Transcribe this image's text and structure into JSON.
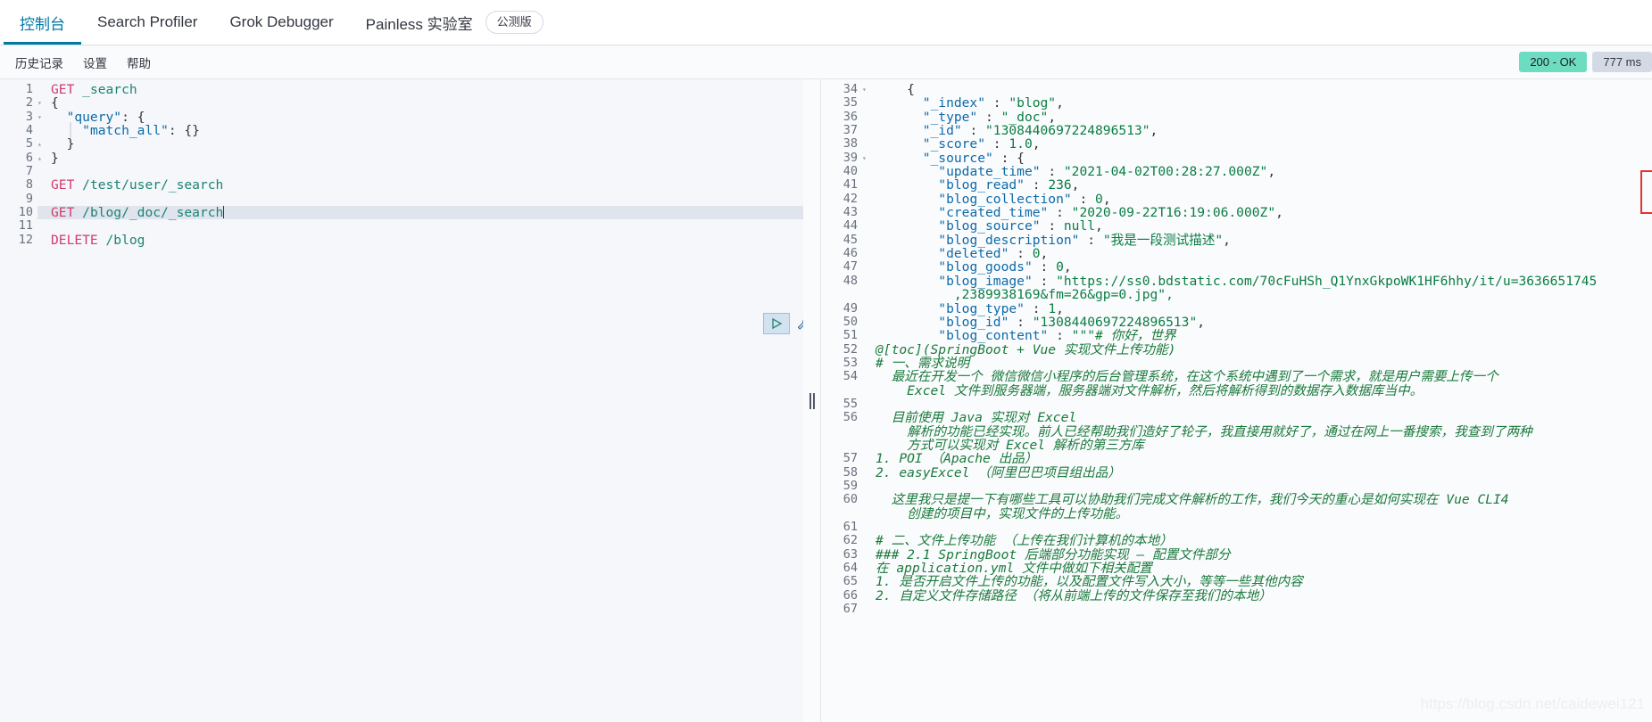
{
  "topbar": {
    "tabs": [
      {
        "label": "控制台",
        "active": true
      },
      {
        "label": "Search Profiler",
        "active": false
      },
      {
        "label": "Grok Debugger",
        "active": false
      },
      {
        "label": "Painless 实验室",
        "active": false
      }
    ],
    "beta_badge": "公测版"
  },
  "submenu": {
    "items": [
      "历史记录",
      "设置",
      "帮助"
    ],
    "status_code": "200 - OK",
    "status_time": "777 ms"
  },
  "colors": {
    "accent": "#0079a5",
    "status_ok_bg": "#6ddcc0",
    "status_time_bg": "#d3dae6",
    "annotation_box": "#e8312f",
    "method": "#d13c6e",
    "url": "#1b8474",
    "key": "#0d6aa8",
    "string": "#0a7d43",
    "markdown": "#1a7a3c",
    "highlight_row": "#dfe4ed"
  },
  "request_editor": {
    "lines": [
      {
        "n": "1",
        "fold": "",
        "segments": [
          {
            "t": "GET",
            "c": "k-method"
          },
          {
            "t": " ",
            "c": "k-plain"
          },
          {
            "t": "_search",
            "c": "k-url"
          }
        ]
      },
      {
        "n": "2",
        "fold": "▾",
        "segments": [
          {
            "t": "{",
            "c": "k-punc"
          }
        ]
      },
      {
        "n": "3",
        "fold": "▾",
        "segments": [
          {
            "t": "  ",
            "c": "k-plain"
          },
          {
            "t": "\"query\"",
            "c": "k-key"
          },
          {
            "t": ": {",
            "c": "k-punc"
          }
        ]
      },
      {
        "n": "4",
        "fold": "",
        "segments": [
          {
            "t": "  │ ",
            "c": "indent-guides"
          },
          {
            "t": "\"match_all\"",
            "c": "k-key"
          },
          {
            "t": ": {}",
            "c": "k-punc"
          }
        ]
      },
      {
        "n": "5",
        "fold": "▴",
        "segments": [
          {
            "t": "  }",
            "c": "k-punc"
          }
        ]
      },
      {
        "n": "6",
        "fold": "▴",
        "segments": [
          {
            "t": "}",
            "c": "k-punc"
          }
        ]
      },
      {
        "n": "7",
        "fold": "",
        "segments": []
      },
      {
        "n": "8",
        "fold": "",
        "segments": [
          {
            "t": "GET",
            "c": "k-method"
          },
          {
            "t": " ",
            "c": "k-plain"
          },
          {
            "t": "/test/user/_search",
            "c": "k-url"
          }
        ]
      },
      {
        "n": "9",
        "fold": "",
        "segments": []
      },
      {
        "n": "10",
        "fold": "",
        "highlight": true,
        "cursor": true,
        "segments": [
          {
            "t": "GET",
            "c": "k-method"
          },
          {
            "t": " ",
            "c": "k-plain"
          },
          {
            "t": "/blog/_doc/_search",
            "c": "k-url"
          }
        ]
      },
      {
        "n": "11",
        "fold": "",
        "segments": []
      },
      {
        "n": "12",
        "fold": "",
        "segments": [
          {
            "t": "DELETE",
            "c": "k-method"
          },
          {
            "t": " ",
            "c": "k-plain"
          },
          {
            "t": "/blog",
            "c": "k-url"
          }
        ]
      }
    ],
    "actions": {
      "play_label": "▷",
      "wrench_label": "🔧"
    }
  },
  "response_editor": {
    "lines": [
      {
        "n": "34",
        "fold": "▾",
        "segments": [
          {
            "t": "    {",
            "c": "k-punc"
          }
        ]
      },
      {
        "n": "35",
        "fold": "",
        "segments": [
          {
            "t": "      ",
            "c": "k-plain"
          },
          {
            "t": "\"_index\"",
            "c": "k-key"
          },
          {
            "t": " : ",
            "c": "k-punc"
          },
          {
            "t": "\"blog\"",
            "c": "k-str"
          },
          {
            "t": ",",
            "c": "k-punc"
          }
        ]
      },
      {
        "n": "36",
        "fold": "",
        "segments": [
          {
            "t": "      ",
            "c": "k-plain"
          },
          {
            "t": "\"_type\"",
            "c": "k-key"
          },
          {
            "t": " : ",
            "c": "k-punc"
          },
          {
            "t": "\"_doc\"",
            "c": "k-str"
          },
          {
            "t": ",",
            "c": "k-punc"
          }
        ]
      },
      {
        "n": "37",
        "fold": "",
        "segments": [
          {
            "t": "      ",
            "c": "k-plain"
          },
          {
            "t": "\"_id\"",
            "c": "k-key"
          },
          {
            "t": " : ",
            "c": "k-punc"
          },
          {
            "t": "\"1308440697224896513\"",
            "c": "k-str"
          },
          {
            "t": ",",
            "c": "k-punc"
          }
        ]
      },
      {
        "n": "38",
        "fold": "",
        "segments": [
          {
            "t": "      ",
            "c": "k-plain"
          },
          {
            "t": "\"_score\"",
            "c": "k-key"
          },
          {
            "t": " : ",
            "c": "k-punc"
          },
          {
            "t": "1.0",
            "c": "k-num"
          },
          {
            "t": ",",
            "c": "k-punc"
          }
        ]
      },
      {
        "n": "39",
        "fold": "▾",
        "segments": [
          {
            "t": "      ",
            "c": "k-plain"
          },
          {
            "t": "\"_source\"",
            "c": "k-key"
          },
          {
            "t": " : {",
            "c": "k-punc"
          }
        ]
      },
      {
        "n": "40",
        "fold": "",
        "segments": [
          {
            "t": "        ",
            "c": "k-plain"
          },
          {
            "t": "\"update_time\"",
            "c": "k-key"
          },
          {
            "t": " : ",
            "c": "k-punc"
          },
          {
            "t": "\"2021-04-02T00:28:27.000Z\"",
            "c": "k-str"
          },
          {
            "t": ",",
            "c": "k-punc"
          }
        ]
      },
      {
        "n": "41",
        "fold": "",
        "segments": [
          {
            "t": "        ",
            "c": "k-plain"
          },
          {
            "t": "\"blog_read\"",
            "c": "k-key"
          },
          {
            "t": " : ",
            "c": "k-punc"
          },
          {
            "t": "236",
            "c": "k-num"
          },
          {
            "t": ",",
            "c": "k-punc"
          }
        ]
      },
      {
        "n": "42",
        "fold": "",
        "segments": [
          {
            "t": "        ",
            "c": "k-plain"
          },
          {
            "t": "\"blog_collection\"",
            "c": "k-key"
          },
          {
            "t": " : ",
            "c": "k-punc"
          },
          {
            "t": "0",
            "c": "k-num"
          },
          {
            "t": ",",
            "c": "k-punc"
          }
        ]
      },
      {
        "n": "43",
        "fold": "",
        "segments": [
          {
            "t": "        ",
            "c": "k-plain"
          },
          {
            "t": "\"created_time\"",
            "c": "k-key"
          },
          {
            "t": " : ",
            "c": "k-punc"
          },
          {
            "t": "\"2020-09-22T16:19:06.000Z\"",
            "c": "k-str"
          },
          {
            "t": ",",
            "c": "k-punc"
          }
        ]
      },
      {
        "n": "44",
        "fold": "",
        "segments": [
          {
            "t": "        ",
            "c": "k-plain"
          },
          {
            "t": "\"blog_source\"",
            "c": "k-key"
          },
          {
            "t": " : ",
            "c": "k-punc"
          },
          {
            "t": "null",
            "c": "k-num"
          },
          {
            "t": ",",
            "c": "k-punc"
          }
        ]
      },
      {
        "n": "45",
        "fold": "",
        "segments": [
          {
            "t": "        ",
            "c": "k-plain"
          },
          {
            "t": "\"blog_description\"",
            "c": "k-key"
          },
          {
            "t": " : ",
            "c": "k-punc"
          },
          {
            "t": "\"我是一段测试描述\"",
            "c": "k-str"
          },
          {
            "t": ",",
            "c": "k-punc"
          }
        ]
      },
      {
        "n": "46",
        "fold": "",
        "segments": [
          {
            "t": "        ",
            "c": "k-plain"
          },
          {
            "t": "\"deleted\"",
            "c": "k-key"
          },
          {
            "t": " : ",
            "c": "k-punc"
          },
          {
            "t": "0",
            "c": "k-num"
          },
          {
            "t": ",",
            "c": "k-punc"
          }
        ]
      },
      {
        "n": "47",
        "fold": "",
        "segments": [
          {
            "t": "        ",
            "c": "k-plain"
          },
          {
            "t": "\"blog_goods\"",
            "c": "k-key"
          },
          {
            "t": " : ",
            "c": "k-punc"
          },
          {
            "t": "0",
            "c": "k-num"
          },
          {
            "t": ",",
            "c": "k-punc"
          }
        ]
      },
      {
        "n": "48",
        "fold": "",
        "wrap": true,
        "segments": [
          {
            "t": "        ",
            "c": "k-plain"
          },
          {
            "t": "\"blog_image\"",
            "c": "k-key"
          },
          {
            "t": " : ",
            "c": "k-punc"
          },
          {
            "t": "\"https://ss0.bdstatic.com/70cFuHSh_Q1YnxGkpoWK1HF6hhy/it/u=3636651745",
            "c": "k-str"
          }
        ]
      },
      {
        "n": "",
        "fold": "",
        "continuation": true,
        "segments": [
          {
            "t": "          ,2389938169&fm=26&gp=0.jpg\",",
            "c": "k-str"
          }
        ]
      },
      {
        "n": "49",
        "fold": "",
        "segments": [
          {
            "t": "        ",
            "c": "k-plain"
          },
          {
            "t": "\"blog_type\"",
            "c": "k-key"
          },
          {
            "t": " : ",
            "c": "k-punc"
          },
          {
            "t": "1",
            "c": "k-num"
          },
          {
            "t": ",",
            "c": "k-punc"
          }
        ]
      },
      {
        "n": "50",
        "fold": "",
        "segments": [
          {
            "t": "        ",
            "c": "k-plain"
          },
          {
            "t": "\"blog_id\"",
            "c": "k-key"
          },
          {
            "t": " : ",
            "c": "k-punc"
          },
          {
            "t": "\"1308440697224896513\"",
            "c": "k-str"
          },
          {
            "t": ",",
            "c": "k-punc"
          }
        ]
      },
      {
        "n": "51",
        "fold": "",
        "segments": [
          {
            "t": "        ",
            "c": "k-plain"
          },
          {
            "t": "\"blog_content\"",
            "c": "k-key"
          },
          {
            "t": " : ",
            "c": "k-punc"
          },
          {
            "t": "\"\"\"",
            "c": "k-str"
          },
          {
            "t": "# 你好，世界",
            "c": "md"
          }
        ]
      },
      {
        "n": "52",
        "fold": "",
        "nogutterbar": true,
        "segments": [
          {
            "t": "@[toc](SpringBoot + Vue 实现文件上传功能)",
            "c": "md"
          }
        ]
      },
      {
        "n": "53",
        "fold": "",
        "nogutterbar": true,
        "segments": [
          {
            "t": "# 一、需求说明",
            "c": "md"
          }
        ]
      },
      {
        "n": "54",
        "fold": "",
        "nogutterbar": true,
        "segments": [
          {
            "t": "  最近在开发一个 微信微信小程序的后台管理系统，在这个系统中遇到了一个需求，就是用户需要上传一个",
            "c": "md"
          }
        ]
      },
      {
        "n": "",
        "fold": "",
        "continuation": true,
        "nogutterbar": true,
        "segments": [
          {
            "t": "    Excel 文件到服务器端，服务器端对文件解析，然后将解析得到的数据存入数据库当中。",
            "c": "md"
          }
        ]
      },
      {
        "n": "55",
        "fold": "",
        "nogutterbar": true,
        "segments": []
      },
      {
        "n": "56",
        "fold": "",
        "nogutterbar": true,
        "segments": [
          {
            "t": "  目前使用 Java 实现对 Excel",
            "c": "md"
          }
        ]
      },
      {
        "n": "",
        "fold": "",
        "continuation": true,
        "nogutterbar": true,
        "segments": [
          {
            "t": "    解析的功能已经实现。前人已经帮助我们造好了轮子，我直接用就好了，通过在网上一番搜索，我查到了两种",
            "c": "md"
          }
        ]
      },
      {
        "n": "",
        "fold": "",
        "continuation": true,
        "nogutterbar": true,
        "segments": [
          {
            "t": "    方式可以实现对 Excel 解析的第三方库",
            "c": "md"
          }
        ]
      },
      {
        "n": "57",
        "fold": "",
        "nogutterbar": true,
        "segments": [
          {
            "t": "1. POI （Apache 出品）",
            "c": "md"
          }
        ]
      },
      {
        "n": "58",
        "fold": "",
        "nogutterbar": true,
        "segments": [
          {
            "t": "2. easyExcel （阿里巴巴项目组出品）",
            "c": "md"
          }
        ]
      },
      {
        "n": "59",
        "fold": "",
        "nogutterbar": true,
        "segments": []
      },
      {
        "n": "60",
        "fold": "",
        "nogutterbar": true,
        "segments": [
          {
            "t": "  这里我只是提一下有哪些工具可以协助我们完成文件解析的工作，我们今天的重心是如何实现在 Vue CLI4",
            "c": "md"
          }
        ]
      },
      {
        "n": "",
        "fold": "",
        "continuation": true,
        "nogutterbar": true,
        "segments": [
          {
            "t": "    创建的项目中，实现文件的上传功能。",
            "c": "md"
          }
        ]
      },
      {
        "n": "61",
        "fold": "",
        "nogutterbar": true,
        "segments": []
      },
      {
        "n": "62",
        "fold": "",
        "nogutterbar": true,
        "segments": [
          {
            "t": "# 二、文件上传功能 （上传在我们计算机的本地）",
            "c": "md"
          }
        ]
      },
      {
        "n": "63",
        "fold": "",
        "nogutterbar": true,
        "segments": [
          {
            "t": "### 2.1 SpringBoot 后端部分功能实现 — 配置文件部分",
            "c": "md"
          }
        ]
      },
      {
        "n": "64",
        "fold": "",
        "nogutterbar": true,
        "segments": [
          {
            "t": "在 application.yml 文件中做如下相关配置",
            "c": "md"
          }
        ]
      },
      {
        "n": "65",
        "fold": "",
        "nogutterbar": true,
        "segments": [
          {
            "t": "1. 是否开启文件上传的功能，以及配置文件写入大小，等等一些其他内容",
            "c": "md"
          }
        ]
      },
      {
        "n": "66",
        "fold": "",
        "nogutterbar": true,
        "segments": [
          {
            "t": "2. 自定义文件存储路径 （将从前端上传的文件保存至我们的本地）",
            "c": "md"
          }
        ]
      },
      {
        "n": "67",
        "fold": "",
        "nogutterbar": true,
        "segments": []
      }
    ]
  },
  "watermark": "https://blog.csdn.net/caidewei121"
}
